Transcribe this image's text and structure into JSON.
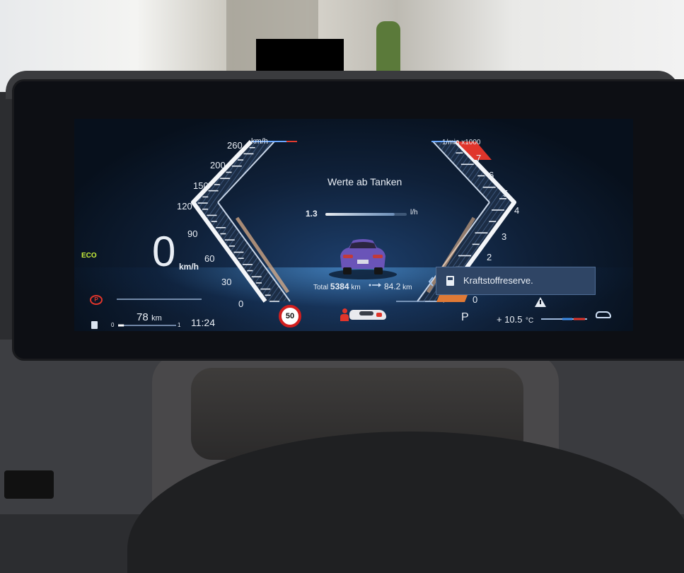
{
  "speedometer": {
    "unit_label": "km/h",
    "ticks": [
      "260",
      "200",
      "150",
      "120",
      "90",
      "60",
      "30",
      "0"
    ],
    "speed_value": "0",
    "speed_unit": "km/h",
    "needle_value": 0
  },
  "tachometer": {
    "unit_label": "1/min x1000",
    "ticks": [
      "7",
      "6",
      "5",
      "4",
      "3",
      "2",
      "0"
    ],
    "rpm_value": 0
  },
  "center": {
    "title": "Werte ab Tanken",
    "consumption_value": "1.3",
    "consumption_unit": "l/h",
    "consumption_level": 0.85,
    "total_label": "Total",
    "total_value": "5384",
    "total_unit": "km",
    "trip_value": "84.2",
    "trip_unit": "km"
  },
  "left_status": {
    "eco_label": "ECO",
    "range_value": "78",
    "range_unit": "km",
    "fuel_scale_min": "0",
    "fuel_scale_max": "1",
    "fuel_level": 0.1,
    "time": "11:24"
  },
  "bottom": {
    "speed_limit": "50",
    "gear": "P",
    "temperature": "+ 10.5",
    "temperature_unit": "°C"
  },
  "notification": {
    "text": "Kraftstoffreserve."
  },
  "colors": {
    "accent_blue": "#3f8ee8",
    "warning_red": "#e0352b",
    "limit_red": "#d21f1f",
    "eco_green": "#c9f03b"
  },
  "icons": [
    "parking-brake-icon",
    "fuel-pump-icon",
    "seatbelt-warning-icon",
    "warning-triangle-icon",
    "car-status-icon",
    "sport-car-icon",
    "route-arrow-icon"
  ]
}
